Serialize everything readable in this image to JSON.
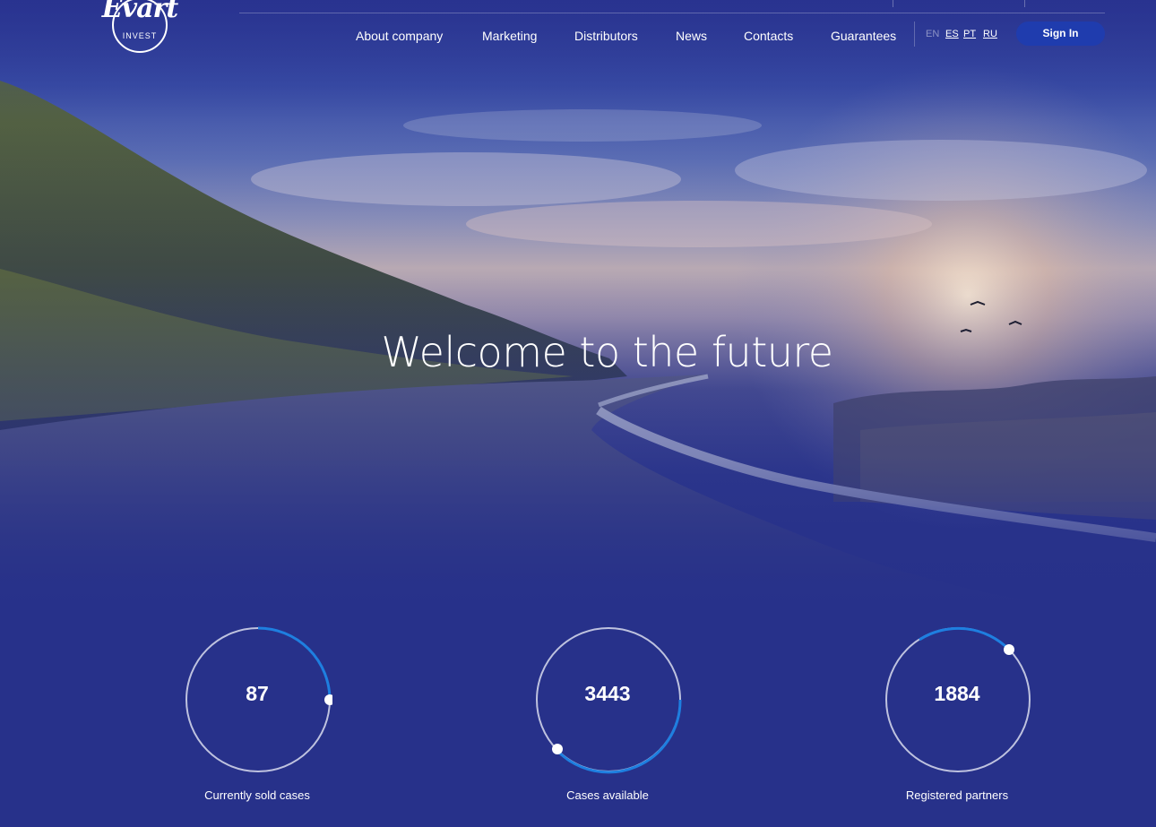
{
  "brand": {
    "logo_text": "Evart",
    "logo_sub": "INVEST"
  },
  "nav": {
    "items": [
      {
        "label": "About company"
      },
      {
        "label": "Marketing"
      },
      {
        "label": "Distributors"
      },
      {
        "label": "News"
      },
      {
        "label": "Contacts"
      },
      {
        "label": "Guarantees"
      }
    ]
  },
  "languages": {
    "en": "EN",
    "es": "ES",
    "pt": "PT",
    "ru": "RU",
    "active": "EN"
  },
  "header": {
    "signin_label": "Sign In"
  },
  "hero": {
    "title": "Welcome to the future"
  },
  "stats": [
    {
      "value": "87",
      "label": "Currently sold cases"
    },
    {
      "value": "3443",
      "label": "Cases available"
    },
    {
      "value": "1884",
      "label": "Registered partners"
    }
  ],
  "colors": {
    "background": "#27318a",
    "accent": "#1f3cae",
    "progress": "#1e7fe0",
    "ring": "#cfd3e8"
  }
}
